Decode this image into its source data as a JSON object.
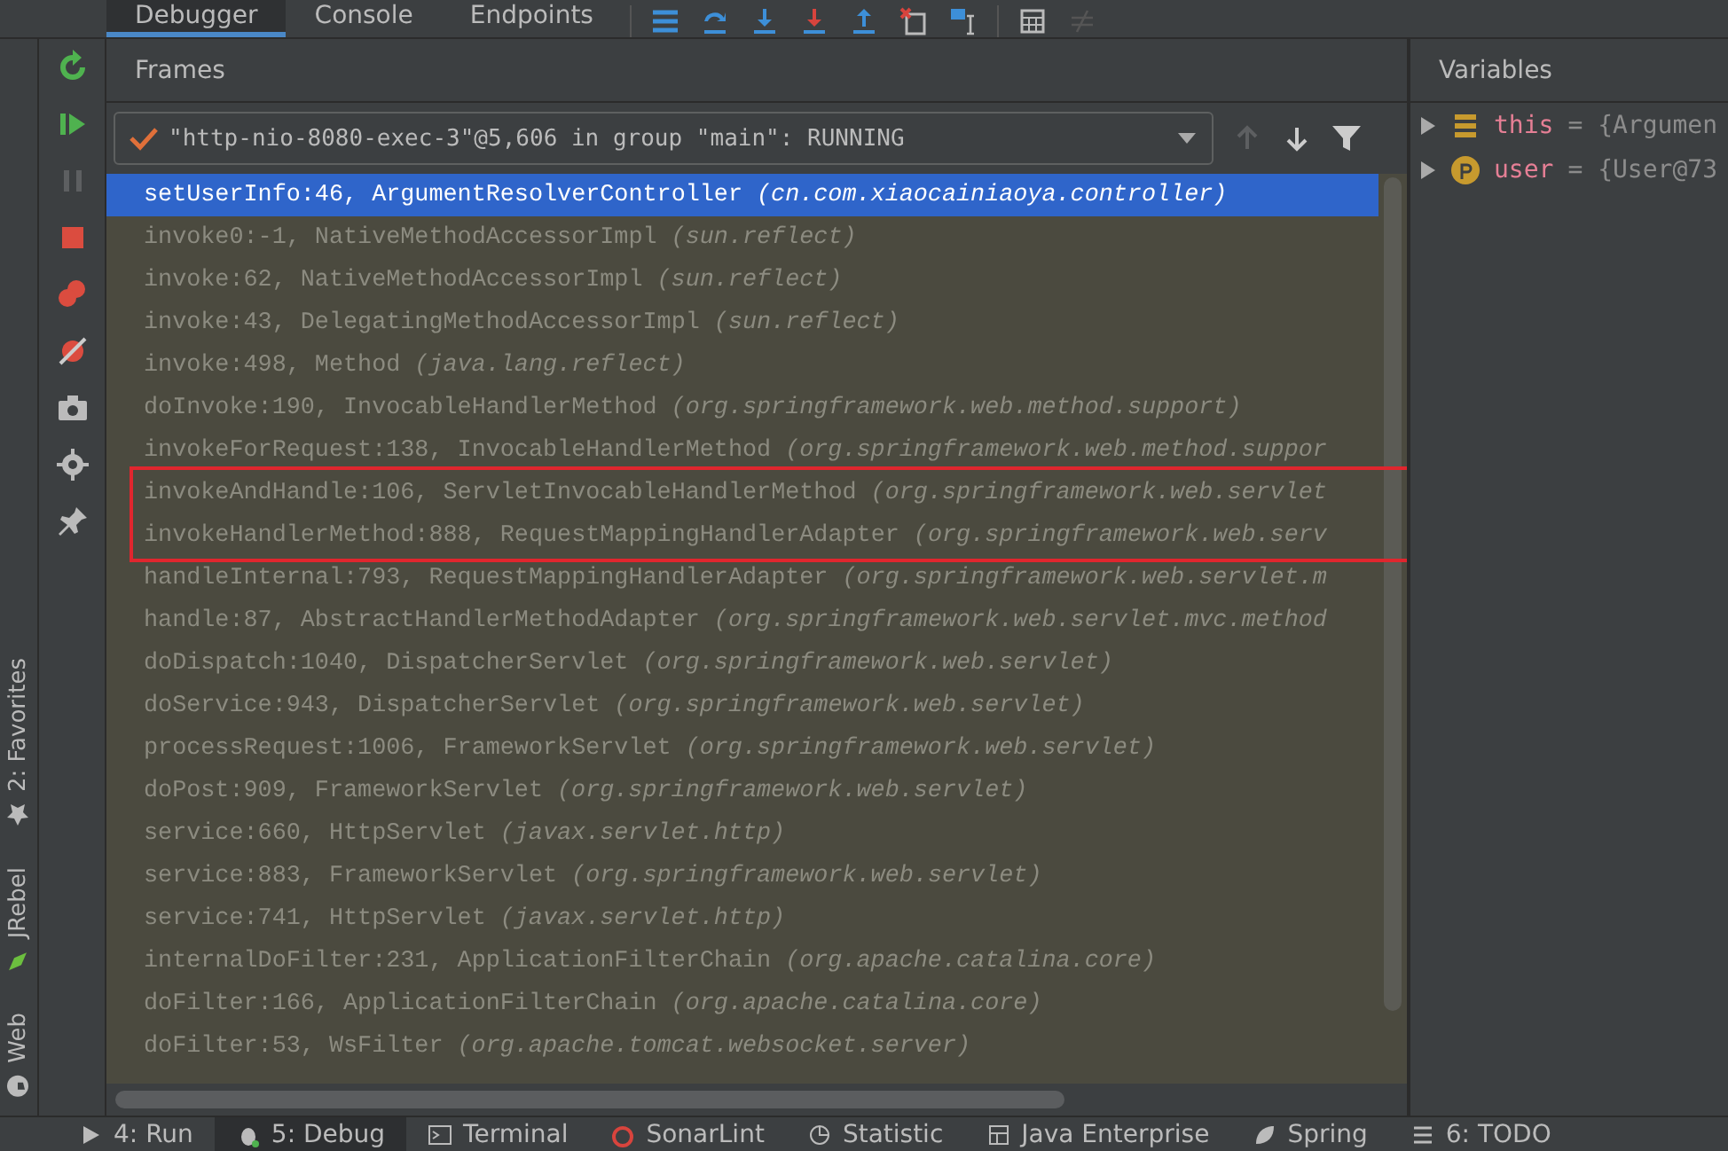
{
  "top_tabs": [
    {
      "label": "Debugger",
      "selected": true
    },
    {
      "label": "Console",
      "selected": false
    },
    {
      "label": "Endpoints",
      "selected": false
    }
  ],
  "frames_panel": {
    "title": "Frames",
    "thread": {
      "text": "\"http-nio-8080-exec-3\"@5,606 in group \"main\": RUNNING"
    },
    "frames": [
      {
        "method": "setUserInfo:46, ArgumentResolverController",
        "package": "(cn.com.xiaocainiaoya.controller)",
        "selected": true
      },
      {
        "method": "invoke0:-1, NativeMethodAccessorImpl",
        "package": "(sun.reflect)",
        "selected": false
      },
      {
        "method": "invoke:62, NativeMethodAccessorImpl",
        "package": "(sun.reflect)",
        "selected": false
      },
      {
        "method": "invoke:43, DelegatingMethodAccessorImpl",
        "package": "(sun.reflect)",
        "selected": false
      },
      {
        "method": "invoke:498, Method",
        "package": "(java.lang.reflect)",
        "selected": false
      },
      {
        "method": "doInvoke:190, InvocableHandlerMethod",
        "package": "(org.springframework.web.method.support)",
        "selected": false
      },
      {
        "method": "invokeForRequest:138, InvocableHandlerMethod",
        "package": "(org.springframework.web.method.suppor",
        "selected": false
      },
      {
        "method": "invokeAndHandle:106, ServletInvocableHandlerMethod",
        "package": "(org.springframework.web.servlet",
        "selected": false
      },
      {
        "method": "invokeHandlerMethod:888, RequestMappingHandlerAdapter",
        "package": "(org.springframework.web.serv",
        "selected": false
      },
      {
        "method": "handleInternal:793, RequestMappingHandlerAdapter",
        "package": "(org.springframework.web.servlet.m",
        "selected": false
      },
      {
        "method": "handle:87, AbstractHandlerMethodAdapter",
        "package": "(org.springframework.web.servlet.mvc.method",
        "selected": false
      },
      {
        "method": "doDispatch:1040, DispatcherServlet",
        "package": "(org.springframework.web.servlet)",
        "selected": false
      },
      {
        "method": "doService:943, DispatcherServlet",
        "package": "(org.springframework.web.servlet)",
        "selected": false
      },
      {
        "method": "processRequest:1006, FrameworkServlet",
        "package": "(org.springframework.web.servlet)",
        "selected": false
      },
      {
        "method": "doPost:909, FrameworkServlet",
        "package": "(org.springframework.web.servlet)",
        "selected": false
      },
      {
        "method": "service:660, HttpServlet",
        "package": "(javax.servlet.http)",
        "selected": false
      },
      {
        "method": "service:883, FrameworkServlet",
        "package": "(org.springframework.web.servlet)",
        "selected": false
      },
      {
        "method": "service:741, HttpServlet",
        "package": "(javax.servlet.http)",
        "selected": false
      },
      {
        "method": "internalDoFilter:231, ApplicationFilterChain",
        "package": "(org.apache.catalina.core)",
        "selected": false
      },
      {
        "method": "doFilter:166, ApplicationFilterChain",
        "package": "(org.apache.catalina.core)",
        "selected": false
      },
      {
        "method": "doFilter:53, WsFilter",
        "package": "(org.apache.tomcat.websocket.server)",
        "selected": false
      }
    ]
  },
  "variables_panel": {
    "title": "Variables",
    "variables": [
      {
        "kind": "field",
        "name": "this",
        "value": "= {Argumen"
      },
      {
        "kind": "param",
        "name": "user",
        "value": "= {User@73"
      }
    ]
  },
  "side_labels": [
    "2: Favorites",
    "JRebel",
    "Web"
  ],
  "bottom_tabs": [
    {
      "label": "4: Run",
      "selected": false
    },
    {
      "label": "5: Debug",
      "selected": true
    },
    {
      "label": "Terminal",
      "selected": false
    },
    {
      "label": "SonarLint",
      "selected": false
    },
    {
      "label": "Statistic",
      "selected": false
    },
    {
      "label": "Java Enterprise",
      "selected": false
    },
    {
      "label": "Spring",
      "selected": false
    },
    {
      "label": "6: TODO",
      "selected": false
    }
  ]
}
